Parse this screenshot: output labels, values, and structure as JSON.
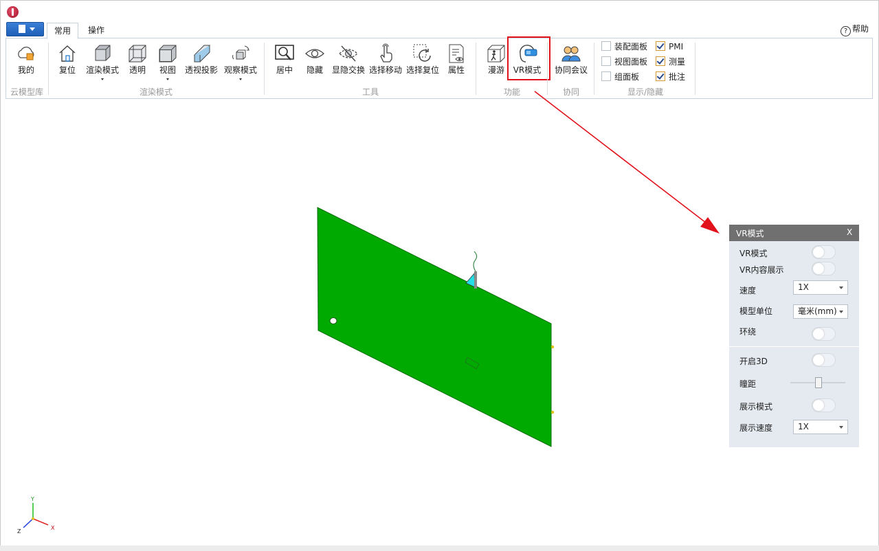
{
  "tabs": [
    "常用",
    "操作"
  ],
  "help": "帮助",
  "ribbon": {
    "buttons": {
      "mine": "我的",
      "reset": "复位",
      "render_mode": "渲染模式",
      "transparent": "透明",
      "view": "视图",
      "perspective": "透视投影",
      "observe_mode": "观察模式",
      "center": "居中",
      "hide": "隐藏",
      "show_hide_swap": "显隐交换",
      "select_move": "选择移动",
      "select_reset": "选择复位",
      "properties": "属性",
      "roam": "漫游",
      "vr_mode": "VR模式",
      "meeting": "协同会议"
    },
    "groups": {
      "cloud": "云模型库",
      "render": "渲染模式",
      "tools": "工具",
      "function": "功能",
      "collab": "协同",
      "display": "显示/隐藏"
    },
    "checkboxes": [
      {
        "label": "装配面板",
        "checked": false
      },
      {
        "label": "视图面板",
        "checked": false
      },
      {
        "label": "组面板",
        "checked": false
      },
      {
        "label": "PMI",
        "checked": true
      },
      {
        "label": "测量",
        "checked": true
      },
      {
        "label": "批注",
        "checked": true
      }
    ]
  },
  "vr_panel": {
    "title": "VR模式",
    "close": "X",
    "rows": {
      "vr_mode": "VR模式",
      "vr_content": "VR内容展示",
      "speed": "速度",
      "unit": "模型单位",
      "orbit": "环绕",
      "open3d": "开启3D",
      "pupil": "瞳距",
      "show_mode": "展示模式",
      "show_speed": "展示速度"
    },
    "speed_value": "1X",
    "unit_value": "毫米(mm)",
    "show_speed_value": "1X",
    "toggles": {
      "vr_mode": false,
      "vr_content": false,
      "orbit": false,
      "open3d": false,
      "show_mode": false
    }
  },
  "axes": {
    "y": "Y",
    "x": "X",
    "z": "Z"
  },
  "colors": {
    "accent": "#1e5fb8",
    "highlight": "#e1121b",
    "plate": "#00aa00",
    "panel_header": "#707070"
  }
}
